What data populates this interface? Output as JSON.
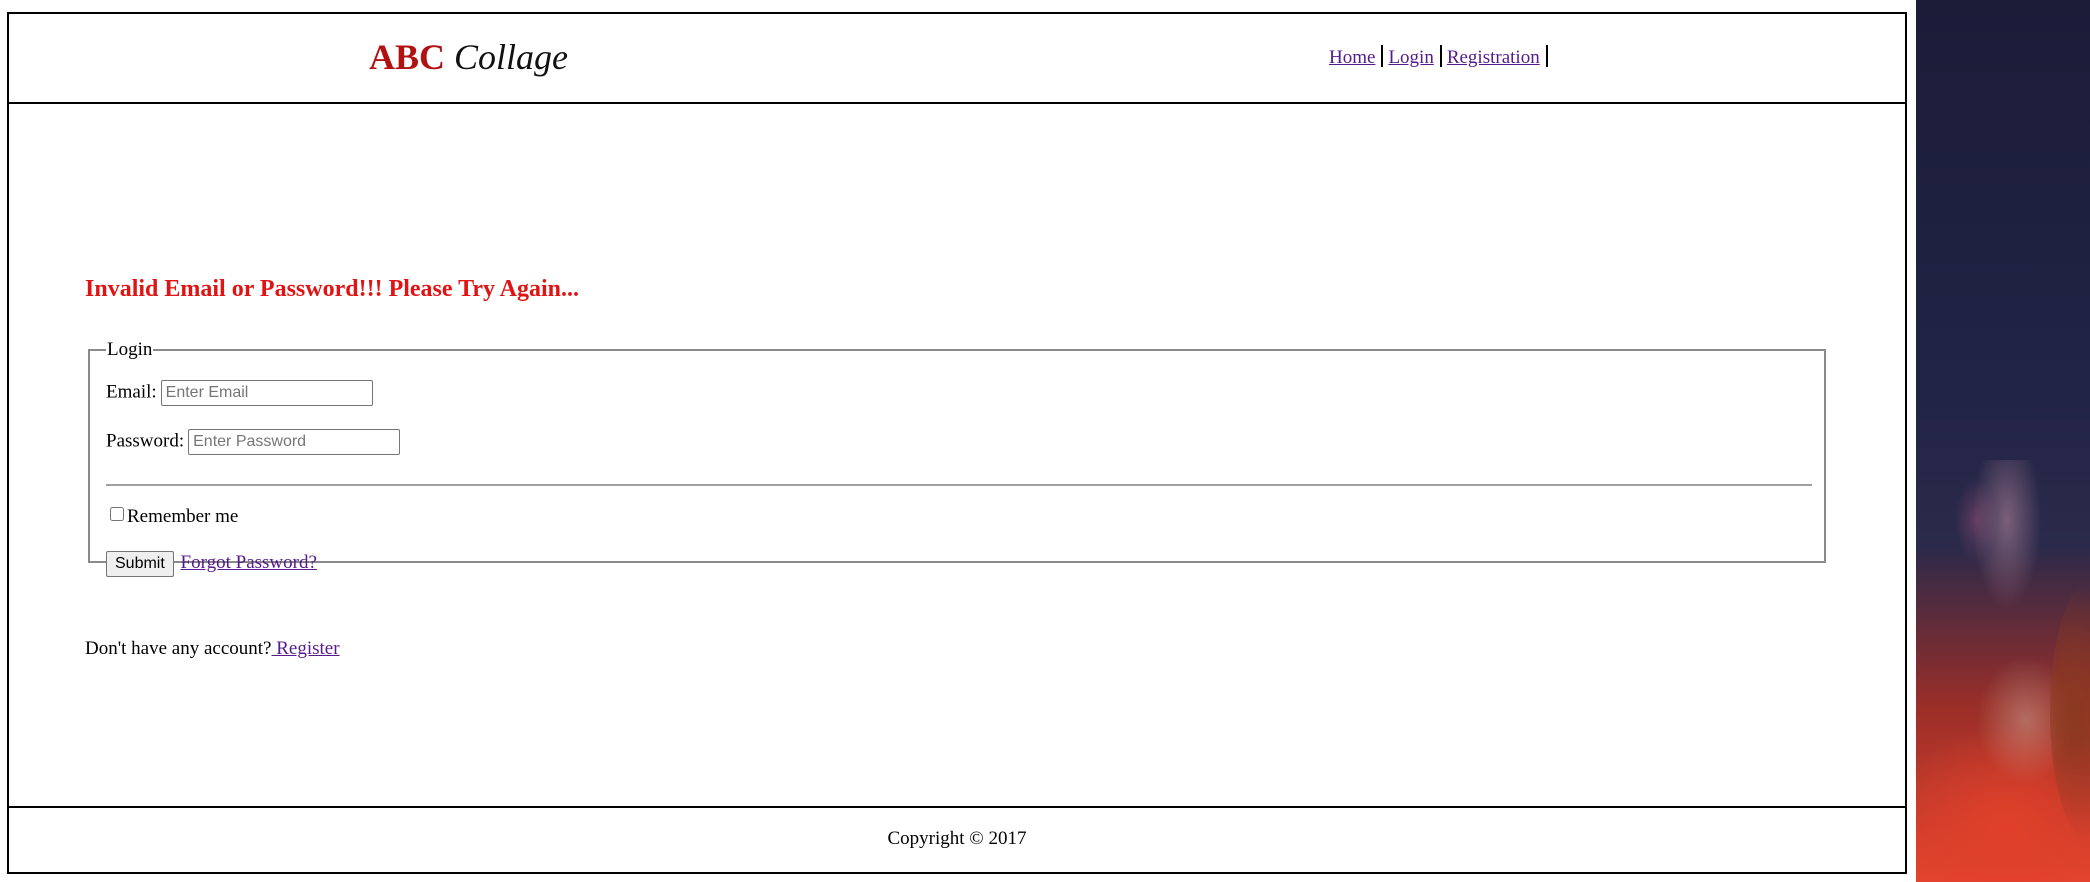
{
  "header": {
    "logo_brand": "ABC",
    "logo_name": "Collage",
    "nav": [
      {
        "label": "Home"
      },
      {
        "label": "Login"
      },
      {
        "label": "Registration"
      }
    ]
  },
  "main": {
    "error_message": "Invalid Email or Password!!! Please Try Again...",
    "login_form": {
      "legend": "Login",
      "email_label": "Email:",
      "email_value": "",
      "email_placeholder": "Enter Email",
      "password_label": "Password:",
      "password_value": "",
      "password_placeholder": "Enter Password",
      "remember_label": "Remember me",
      "remember_checked": false,
      "submit_label": "Submit",
      "forgot_label": "Forgot Password?"
    },
    "no_account_text": "Don't have any account?",
    "register_link": " Register"
  },
  "footer": {
    "copyright": "Copyright © 2017"
  },
  "colors": {
    "brand_red": "#b01212",
    "error_red": "#e01414",
    "visited_link": "#551a8b"
  }
}
